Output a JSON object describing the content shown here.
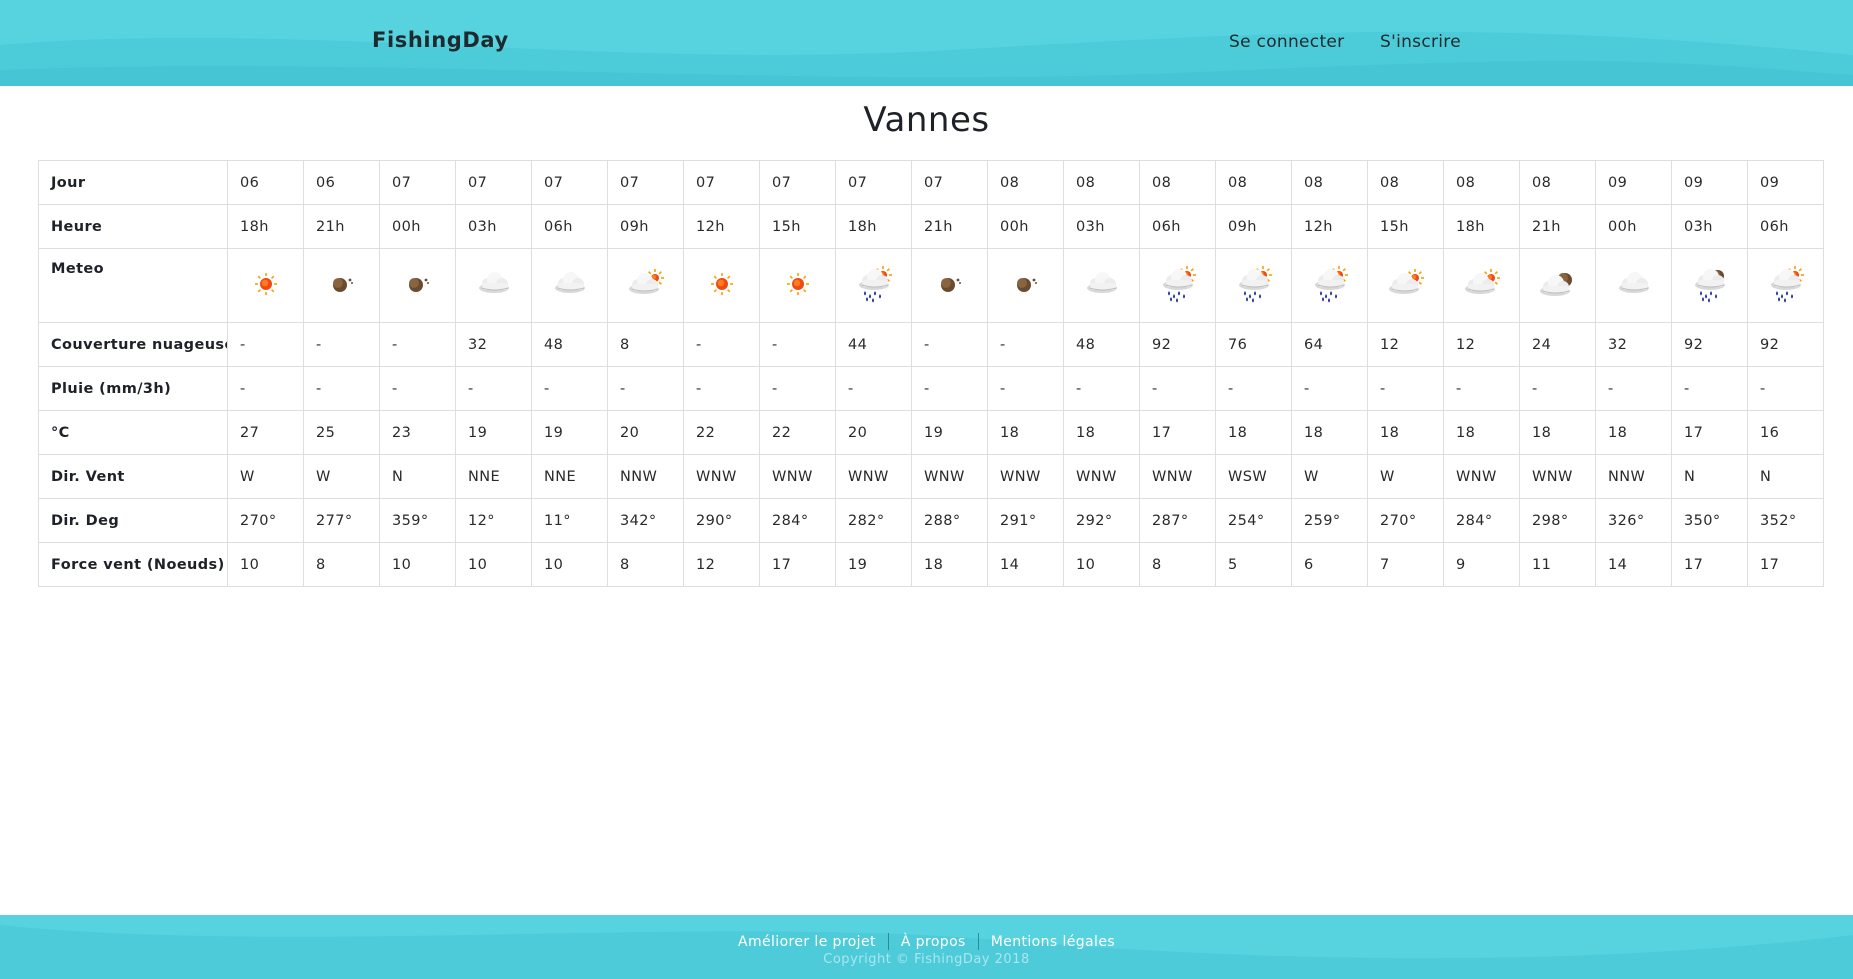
{
  "header": {
    "brand": "FishingDay",
    "login_label": "Se connecter",
    "signup_label": "S'inscrire"
  },
  "page": {
    "title": "Vannes"
  },
  "table": {
    "rows": [
      {
        "label": "Jour",
        "values": [
          "06",
          "06",
          "07",
          "07",
          "07",
          "07",
          "07",
          "07",
          "07",
          "07",
          "08",
          "08",
          "08",
          "08",
          "08",
          "08",
          "08",
          "08",
          "09",
          "09",
          "09"
        ]
      },
      {
        "label": "Heure",
        "values": [
          "18h",
          "21h",
          "00h",
          "03h",
          "06h",
          "09h",
          "12h",
          "15h",
          "18h",
          "21h",
          "00h",
          "03h",
          "06h",
          "09h",
          "12h",
          "15h",
          "18h",
          "21h",
          "00h",
          "03h",
          "06h"
        ]
      },
      {
        "label": "Meteo",
        "icons": [
          "sun-icon",
          "moon-icon",
          "moon-icon",
          "cloud-icon",
          "cloud-icon",
          "cloud-sun-icon",
          "sun-icon",
          "sun-icon",
          "rain-sun-icon",
          "moon-icon",
          "moon-icon",
          "cloud-icon",
          "rain-sun-icon",
          "rain-sun-icon",
          "rain-sun-icon",
          "cloud-sun-icon",
          "cloud-sun-icon",
          "cloud-moon-icon",
          "cloud-icon",
          "rain-moon-icon",
          "rain-sun-icon"
        ]
      },
      {
        "label": "Couverture nuageuse %",
        "values": [
          "-",
          "-",
          "-",
          "32",
          "48",
          "8",
          "-",
          "-",
          "44",
          "-",
          "-",
          "48",
          "92",
          "76",
          "64",
          "12",
          "12",
          "24",
          "32",
          "92",
          "92"
        ]
      },
      {
        "label": "Pluie (mm/3h)",
        "values": [
          "-",
          "-",
          "-",
          "-",
          "-",
          "-",
          "-",
          "-",
          "-",
          "-",
          "-",
          "-",
          "-",
          "-",
          "-",
          "-",
          "-",
          "-",
          "-",
          "-",
          "-"
        ]
      },
      {
        "label": "°C",
        "values": [
          "27",
          "25",
          "23",
          "19",
          "19",
          "20",
          "22",
          "22",
          "20",
          "19",
          "18",
          "18",
          "17",
          "18",
          "18",
          "18",
          "18",
          "18",
          "18",
          "17",
          "16"
        ]
      },
      {
        "label": "Dir. Vent",
        "values": [
          "W",
          "W",
          "N",
          "NNE",
          "NNE",
          "NNW",
          "WNW",
          "WNW",
          "WNW",
          "WNW",
          "WNW",
          "WNW",
          "WNW",
          "WSW",
          "W",
          "W",
          "WNW",
          "WNW",
          "NNW",
          "N",
          "N"
        ]
      },
      {
        "label": "Dir. Deg",
        "values": [
          "270°",
          "277°",
          "359°",
          "12°",
          "11°",
          "342°",
          "290°",
          "284°",
          "282°",
          "288°",
          "291°",
          "292°",
          "287°",
          "254°",
          "259°",
          "270°",
          "284°",
          "298°",
          "326°",
          "350°",
          "352°"
        ]
      },
      {
        "label": "Force vent (Noeuds)",
        "values": [
          "10",
          "8",
          "10",
          "10",
          "10",
          "8",
          "12",
          "17",
          "19",
          "18",
          "14",
          "10",
          "8",
          "5",
          "6",
          "7",
          "9",
          "11",
          "14",
          "17",
          "17"
        ]
      }
    ]
  },
  "footer": {
    "links": [
      "Améliorer le projet",
      "À propos",
      "Mentions légales"
    ],
    "copyright": "Copyright © FishingDay 2018"
  },
  "colors": {
    "header_bg": "#57d3e0",
    "footer_bg": "#57d3e0"
  }
}
